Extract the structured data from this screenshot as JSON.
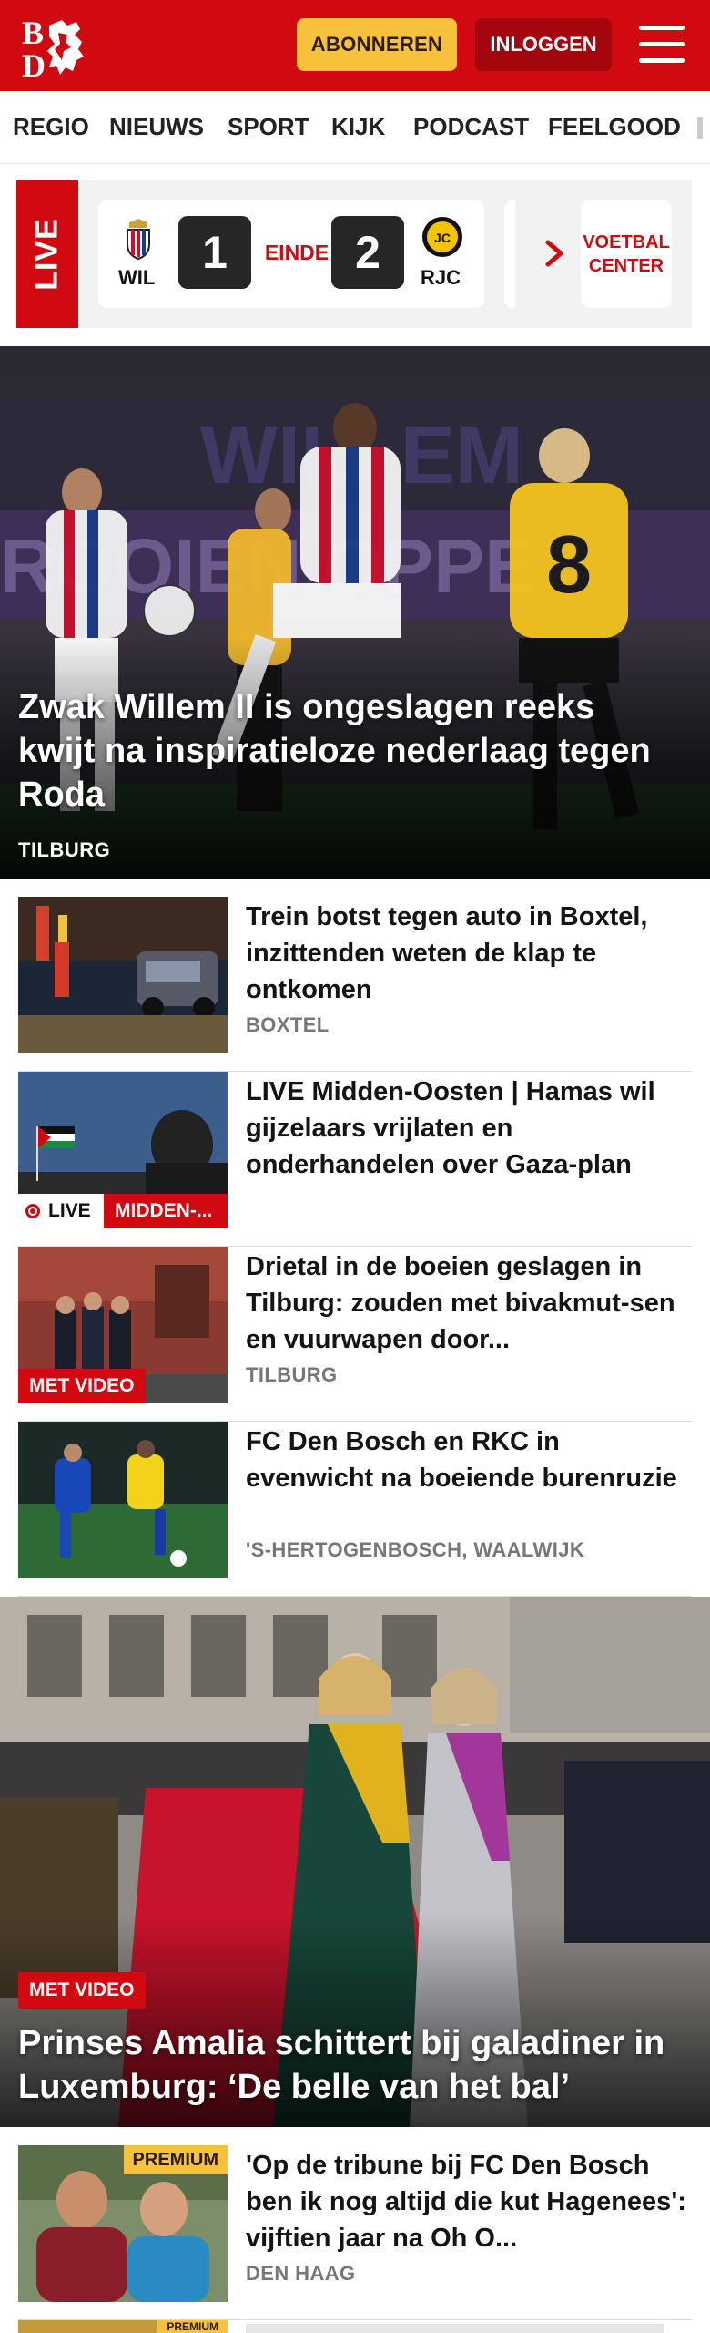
{
  "header": {
    "logo_text": "BD",
    "subscribe_label": "ABONNEREN",
    "login_label": "INLOGGEN",
    "menu_icon": "hamburger-menu-icon",
    "brand_color": "#d10a11",
    "accent_color": "#f7c23b"
  },
  "nav": {
    "items": [
      {
        "label": "REGIO"
      },
      {
        "label": "NIEUWS"
      },
      {
        "label": "SPORT"
      },
      {
        "label": "KIJK"
      },
      {
        "label": "PODCAST"
      },
      {
        "label": "FEELGOOD"
      }
    ]
  },
  "live_strip": {
    "tab_label": "LIVE",
    "match": {
      "home_code": "WIL",
      "away_code": "RJC",
      "home_score": "1",
      "away_score": "2",
      "status": "EINDE"
    },
    "voetbal_center_label": "VOETBAL CENTER"
  },
  "hero": {
    "title": "Zwak Willem II is ongeslagen reeks kwijt na inspiratieloze nederlaag tegen Roda",
    "location": "TILBURG"
  },
  "articles": [
    {
      "title": "Trein botst tegen auto in Boxtel, inzittenden weten de klap te ontkomen",
      "location": "BOXTEL"
    },
    {
      "title": "LIVE Midden-Oosten | Hamas wil gijzelaars vrijlaten en onderhandelen over Gaza-plan",
      "live_label": "LIVE",
      "tag": "MIDDEN-..."
    },
    {
      "title": "Drietal in de boeien geslagen in Tilburg: zouden met bivakmut-sen en vuurwapen door...",
      "location": "TILBURG",
      "badge": "MET VIDEO"
    },
    {
      "title": "FC Den Bosch en RKC in evenwicht na boeiende burenruzie",
      "location": "'S-HERTOGENBOSCH, WAALWIJK"
    }
  ],
  "hero2": {
    "badge": "MET VIDEO",
    "title": "Prinses Amalia schittert bij galadiner in Luxemburg: ‘De belle van het bal’"
  },
  "articles2": [
    {
      "title": "'Op de tribune bij FC Den Bosch ben ik nog altijd die kut Hagenees': vijftien jaar na Oh O...",
      "location": "DEN HAAG",
      "badge": "PREMIUM"
    },
    {
      "badge": "PREMIUM"
    }
  ]
}
